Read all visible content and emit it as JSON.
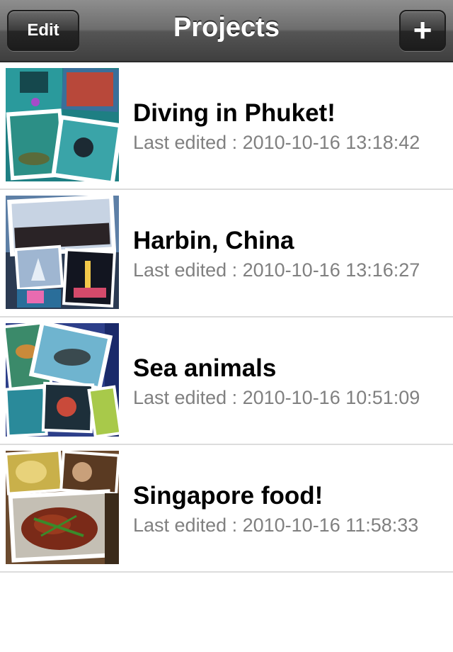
{
  "navbar": {
    "title": "Projects",
    "edit_label": "Edit",
    "add_label": "+"
  },
  "projects": [
    {
      "title": "Diving in Phuket!",
      "subtitle": "Last edited : 2010-10-16 13:18:42"
    },
    {
      "title": "Harbin, China",
      "subtitle": "Last edited : 2010-10-16 13:16:27"
    },
    {
      "title": "Sea animals",
      "subtitle": "Last edited : 2010-10-16 10:51:09"
    },
    {
      "title": "Singapore food!",
      "subtitle": "Last edited : 2010-10-16 11:58:33"
    }
  ],
  "colors": {
    "navbar_top": "#8e8e8e",
    "navbar_bottom": "#3f3f3f",
    "subtitle_text": "#808080",
    "separator": "#dcdcdc"
  }
}
